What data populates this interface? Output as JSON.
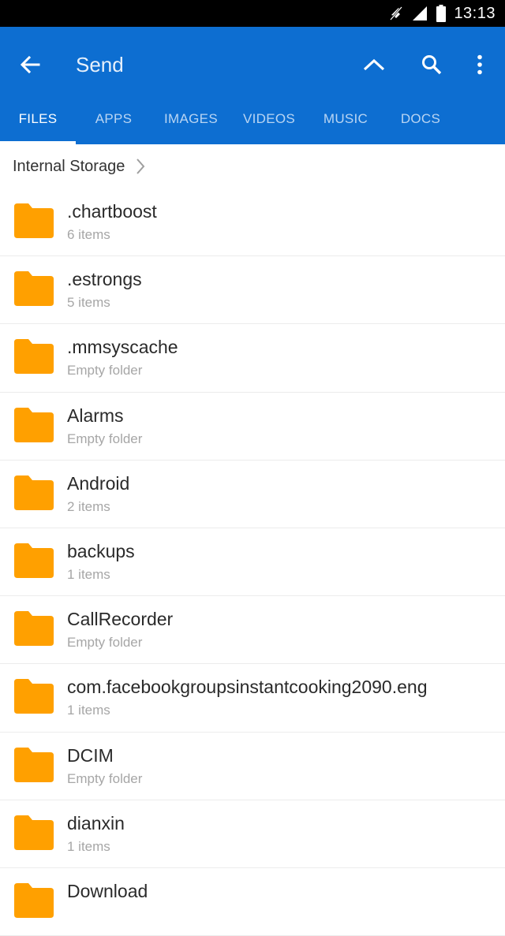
{
  "status_bar": {
    "time": "13:13",
    "icons": [
      "mute-icon",
      "signal-icon",
      "battery-icon"
    ]
  },
  "app_bar": {
    "title": "Send",
    "background_color": "#0d6ed1",
    "icons": [
      "back-arrow-icon",
      "chevron-up-icon",
      "search-icon",
      "more-vert-icon"
    ]
  },
  "tabs": [
    {
      "label": "FILES",
      "active": true
    },
    {
      "label": "APPS",
      "active": false
    },
    {
      "label": "IMAGES",
      "active": false
    },
    {
      "label": "VIDEOS",
      "active": false
    },
    {
      "label": "MUSIC",
      "active": false
    },
    {
      "label": "DOCS",
      "active": false
    }
  ],
  "breadcrumb": {
    "label": "Internal Storage",
    "icon": "chevron-right-icon"
  },
  "folder_color": "#ffa000",
  "files": [
    {
      "name": ".chartboost",
      "meta": "6 items"
    },
    {
      "name": ".estrongs",
      "meta": "5 items"
    },
    {
      "name": ".mmsyscache",
      "meta": "Empty folder"
    },
    {
      "name": "Alarms",
      "meta": "Empty folder"
    },
    {
      "name": "Android",
      "meta": "2 items"
    },
    {
      "name": "backups",
      "meta": "1 items"
    },
    {
      "name": "CallRecorder",
      "meta": "Empty folder"
    },
    {
      "name": "com.facebookgroupsinstantcooking2090.eng",
      "meta": "1 items"
    },
    {
      "name": "DCIM",
      "meta": "Empty folder"
    },
    {
      "name": "dianxin",
      "meta": "1 items"
    },
    {
      "name": "Download",
      "meta": ""
    }
  ]
}
